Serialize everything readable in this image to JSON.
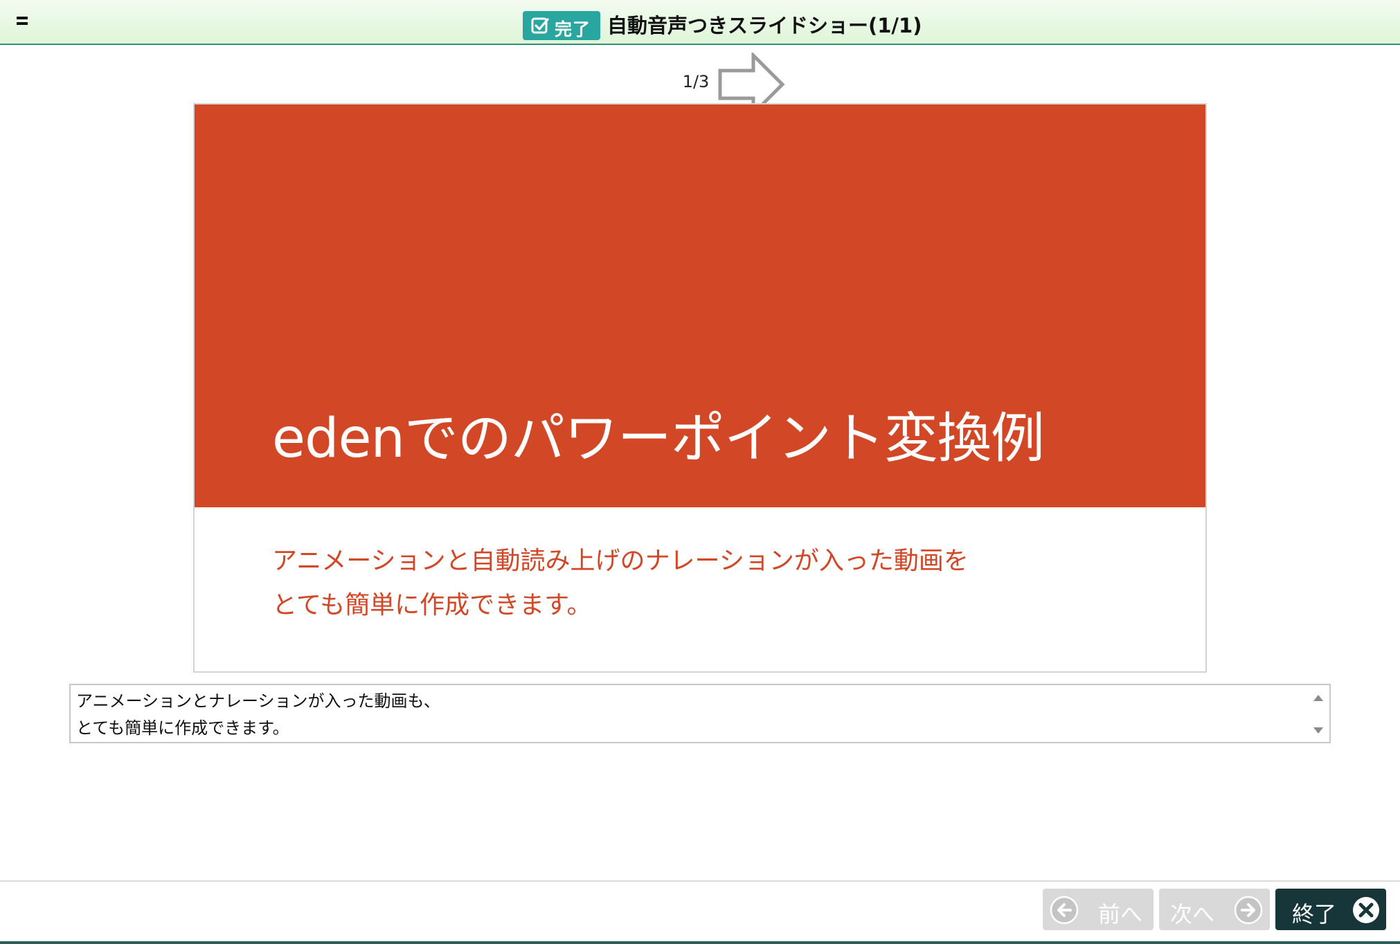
{
  "header": {
    "done_label": "完了",
    "title": "自動音声つきスライドショー(1/1)"
  },
  "slide": {
    "counter": "1/3",
    "title": "edenでのパワーポイント変換例",
    "subtitle_lines": [
      "アニメーションと自動読み上げのナレーションが入った動画を",
      "とても簡単に作成できます。"
    ]
  },
  "narration": {
    "lines": [
      "アニメーションとナレーションが入った動画も、",
      "とても簡単に作成できます。"
    ]
  },
  "footer": {
    "prev_label": "前へ",
    "next_label": "次へ",
    "end_label": "終了"
  },
  "colors": {
    "accent": "#d24726",
    "header_bg": "#dff5d9",
    "done_badge": "#2aa6a0",
    "disabled_button": "#d9d9d9",
    "end_button": "#17363a"
  },
  "icons": {
    "menu": "menu-icon",
    "done": "checkbox-icon",
    "next_slide": "arrow-right-outline-icon",
    "prev": "arrow-left-circle-icon",
    "next": "arrow-right-circle-icon",
    "end": "close-circle-icon"
  }
}
